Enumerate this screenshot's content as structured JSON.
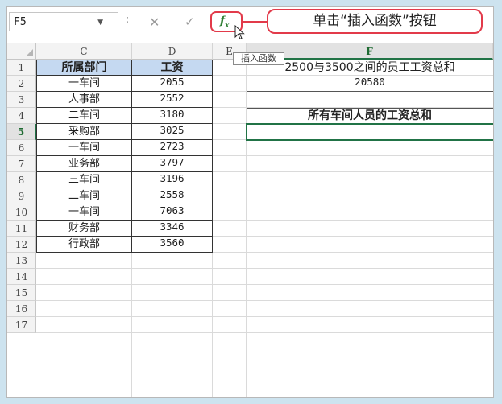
{
  "formula_bar": {
    "name_box": "F5",
    "separator": ":",
    "cancel_icon": "close-icon",
    "enter_icon": "check-icon",
    "fx_label": "fx",
    "tooltip": "插入函数",
    "callout": "单击“插入函数”按钮"
  },
  "columns": [
    "C",
    "D",
    "E",
    "F"
  ],
  "rows": [
    "1",
    "2",
    "3",
    "4",
    "5",
    "6",
    "7",
    "8",
    "9",
    "10",
    "11",
    "12",
    "13",
    "14",
    "15",
    "16",
    "17"
  ],
  "table": {
    "headers": [
      "所属部门",
      "工资"
    ],
    "rows": [
      [
        "一车间",
        "2055"
      ],
      [
        "人事部",
        "2552"
      ],
      [
        "二车间",
        "3180"
      ],
      [
        "采购部",
        "3025"
      ],
      [
        "一车间",
        "2723"
      ],
      [
        "业务部",
        "3797"
      ],
      [
        "三车间",
        "3196"
      ],
      [
        "二车间",
        "2558"
      ],
      [
        "一车间",
        "7063"
      ],
      [
        "财务部",
        "3346"
      ],
      [
        "行政部",
        "3560"
      ]
    ]
  },
  "f_column": {
    "f1": "2500与3500之间的员工工资总和",
    "f2": "20580",
    "f4": "所有车间人员的工资总和",
    "f5": ""
  },
  "colors": {
    "header_fill": "#c5d9f1",
    "accent_red": "#e23a4a",
    "excel_green": "#217346"
  }
}
